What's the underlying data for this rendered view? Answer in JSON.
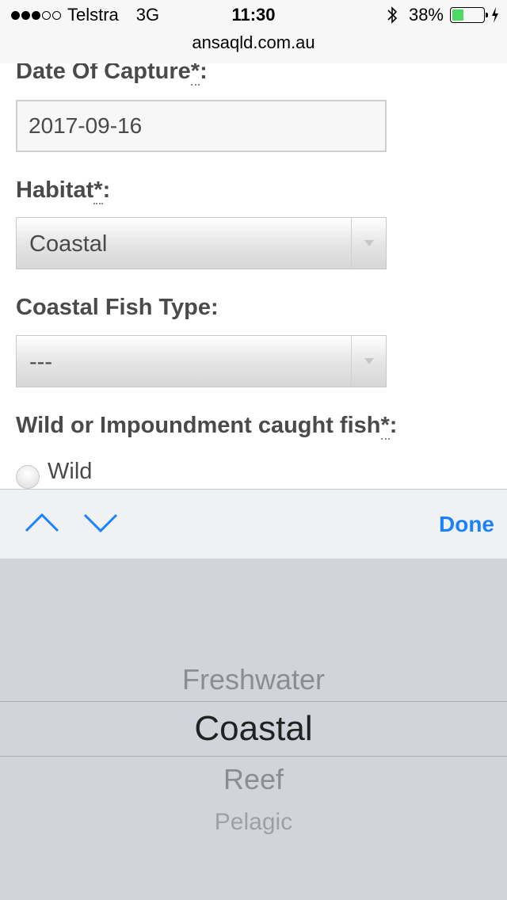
{
  "status_bar": {
    "carrier": "Telstra",
    "network": "3G",
    "time": "11:30",
    "battery": "38%",
    "battery_level": 0.38,
    "signal_dots_filled": 3,
    "signal_dots_total": 5,
    "icons": [
      "bluetooth-icon",
      "battery-icon",
      "charging-bolt-icon"
    ]
  },
  "url_bar": {
    "domain": "ansaqld.com.au"
  },
  "form": {
    "date_label": "Date Of Capture",
    "date_value": "2017-09-16",
    "habitat_label": "Habitat",
    "habitat_value": "Coastal",
    "fish_type_label": "Coastal Fish Type:",
    "fish_type_value": "---",
    "wild_label": "Wild or Impoundment caught fish",
    "required_mark": "*",
    "colon": ":",
    "radio_wild": "Wild"
  },
  "accessory": {
    "done_label": "Done",
    "icons": [
      "chevron-up-icon",
      "chevron-down-icon"
    ]
  },
  "picker": {
    "options": [
      "Freshwater",
      "Coastal",
      "Reef",
      "Pelagic"
    ],
    "selected": "Coastal"
  },
  "colors": {
    "accent": "#1a82fb",
    "battery_fill": "#4cd964",
    "picker_bg": "#d1d4da"
  }
}
